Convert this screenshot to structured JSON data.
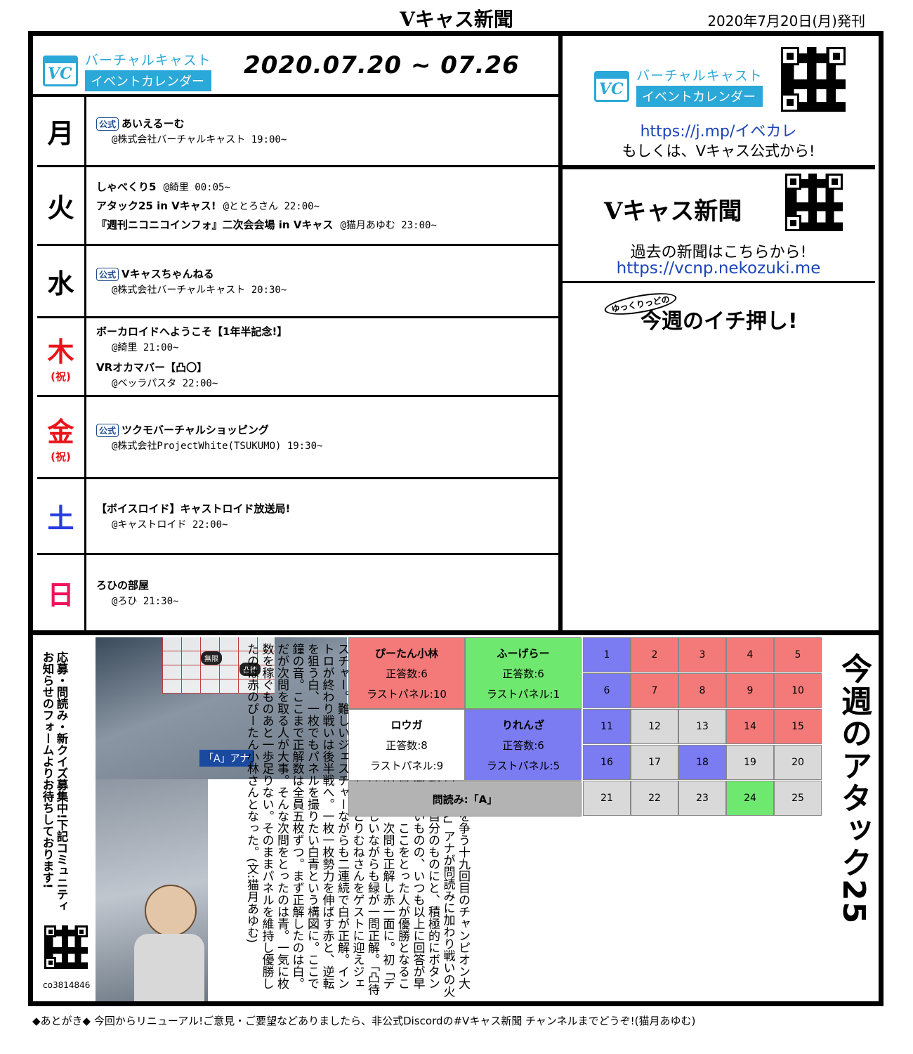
{
  "header": {
    "title": "Vキャス新聞",
    "date": "2020年7月20日(月)発刊"
  },
  "calendar": {
    "logo_line1": "バーチャルキャスト",
    "logo_line2": "イベントカレンダー",
    "logo_mark": "VC",
    "week_range": "2020.07.20 ~ 07.26",
    "days": [
      {
        "label": "月",
        "holiday": "",
        "color": "#000000",
        "events": [
          {
            "badge": "公式",
            "title": "あいえるーむ",
            "sub": "@株式会社バーチャルキャスト 19:00~"
          }
        ]
      },
      {
        "label": "火",
        "holiday": "",
        "color": "#000000",
        "events": [
          {
            "badge": "",
            "title": "しゃべくり5",
            "inline": "@綺里 00:05~"
          },
          {
            "badge": "",
            "title": "アタック25 in Vキャス!",
            "inline": "@ととろさん 22:00~"
          },
          {
            "badge": "",
            "title": "『週刊ニコニコインフォ』二次会会場 in Vキャス",
            "inline": "@猫月あゆむ 23:00~"
          }
        ]
      },
      {
        "label": "水",
        "holiday": "",
        "color": "#000000",
        "events": [
          {
            "badge": "公式",
            "title": "Vキャスちゃんねる",
            "sub": "@株式会社バーチャルキャスト 20:30~"
          }
        ]
      },
      {
        "label": "木",
        "holiday": "(祝)",
        "color": "#e8141a",
        "events": [
          {
            "badge": "",
            "title": "ボーカロイドへようこそ【1年半記念!】",
            "sub": "@綺里 21:00~"
          },
          {
            "badge": "",
            "title": "VRオカマバー【凸〇】",
            "sub": "@ベッラパスタ 22:00~"
          }
        ]
      },
      {
        "label": "金",
        "holiday": "(祝)",
        "color": "#e8141a",
        "events": [
          {
            "badge": "公式",
            "title": "ツクモバーチャルショッピング",
            "sub": "@株式会社ProjectWhite(TSUKUMO) 19:30~"
          }
        ]
      },
      {
        "label": "土",
        "holiday": "",
        "color": "#2a3ce0",
        "events": [
          {
            "badge": "",
            "title": "【ボイスロイド】キャストロイド放送局!",
            "sub": "@キャストロイド 22:00~"
          }
        ]
      },
      {
        "label": "日",
        "holiday": "",
        "color": "#f0145a",
        "events": [
          {
            "badge": "",
            "title": "ろひの部屋",
            "sub": "@ろひ 21:30~"
          }
        ]
      }
    ]
  },
  "side": {
    "calendar_url": "https://j.mp/イベカレ",
    "calendar_note": "もしくは、Vキャス公式から!",
    "paper_title": "Vキャス新聞",
    "paper_note": "過去の新聞はこちらから!",
    "paper_url": "https://vcnp.nekozuki.me",
    "pick_small": "ゆっくりっどの",
    "pick_title": "今週のイチ押し!"
  },
  "attack": {
    "recruit": "応募・問読み・新クイズ募集中!下記コミュニティお知らせのフォームよりお待ちしております!",
    "community_id": "co3814846",
    "players": [
      {
        "name": "ぴーたん小林",
        "correct": "正答数:6",
        "last": "ラストパネル:10",
        "color": "#f47a7a"
      },
      {
        "name": "ふーげらー",
        "correct": "正答数:6",
        "last": "ラストパネル:1",
        "color": "#6ee86e"
      },
      {
        "name": "ロウガ",
        "correct": "正答数:8",
        "last": "ラストパネル:9",
        "color": "#ffffff"
      },
      {
        "name": "りれんざ",
        "correct": "正答数:6",
        "last": "ラストパネル:5",
        "color": "#7b7bf2"
      }
    ],
    "reader": "問読み:「A」",
    "panels": [
      {
        "n": "1",
        "c": "#7b7bf2"
      },
      {
        "n": "2",
        "c": "#f47a7a"
      },
      {
        "n": "3",
        "c": "#f47a7a"
      },
      {
        "n": "4",
        "c": "#f47a7a"
      },
      {
        "n": "5",
        "c": "#f47a7a"
      },
      {
        "n": "6",
        "c": "#7b7bf2"
      },
      {
        "n": "7",
        "c": "#f47a7a"
      },
      {
        "n": "8",
        "c": "#f47a7a"
      },
      {
        "n": "9",
        "c": "#f47a7a"
      },
      {
        "n": "10",
        "c": "#f47a7a"
      },
      {
        "n": "11",
        "c": "#7b7bf2"
      },
      {
        "n": "12",
        "c": "#d9d9d9"
      },
      {
        "n": "13",
        "c": "#d9d9d9"
      },
      {
        "n": "14",
        "c": "#f47a7a"
      },
      {
        "n": "15",
        "c": "#f47a7a"
      },
      {
        "n": "16",
        "c": "#7b7bf2"
      },
      {
        "n": "17",
        "c": "#d9d9d9"
      },
      {
        "n": "18",
        "c": "#7b7bf2"
      },
      {
        "n": "19",
        "c": "#d9d9d9"
      },
      {
        "n": "20",
        "c": "#d9d9d9"
      },
      {
        "n": "21",
        "c": "#d9d9d9"
      },
      {
        "n": "22",
        "c": "#d9d9d9"
      },
      {
        "n": "23",
        "c": "#d9d9d9"
      },
      {
        "n": "24",
        "c": "#6ee86e"
      },
      {
        "n": "25",
        "c": "#d9d9d9"
      }
    ],
    "vertical_title": "今週のアタック25",
    "article": "つよつよメガネ勢が集い、優勝を争う十九回目のチャンピオン大会。某キャラに十分似ていた「A」アナが問読みに加わり戦いの火蓋が切られた。序盤から勢いを自分のものにと、積極的にボタンを押していく。お手つき率は多いものの、いつも以上に回答が早い。あっという間に一つ目の角。ここをとった人が優勝となることが多いパネルに入ったのは赤。次問も正解し赤一面に。初「デュアルクロスクイズ」では、難しいながらも緑が一問正解。「凸待ちジェスチャークイズ」では、とりむねさんをゲストに迎えジェスチャー。難しいジェスチャーながらも二連続で白が正解。イントロが終わり戦いは後半戦へ。一枚一枚勢力を伸ばす赤と、逆転を狙う白、一枚でもパネルを撮りたい白青という構図に。ここで鐘の音。ここまで正解数は全員五枚ずつ。まず正解したのは白。だが次問を取る人が大事。そんな次問をとったのは青。一気に枚数を稼ぐものあと一歩足りない。そのままパネルを維持し優勝したのは赤のぴーたん小林さんとなった。(文:猫月あゆむ)",
    "photo_sign1": "無限",
    "photo_sign2": "凸待",
    "photo_sign3": "「A」アナ"
  },
  "footer": "◆あとがき◆ 今回からリニューアル!ご意見・ご要望などありましたら、非公式Discordの#Vキャス新聞 チャンネルまでどうぞ!(猫月あゆむ)"
}
